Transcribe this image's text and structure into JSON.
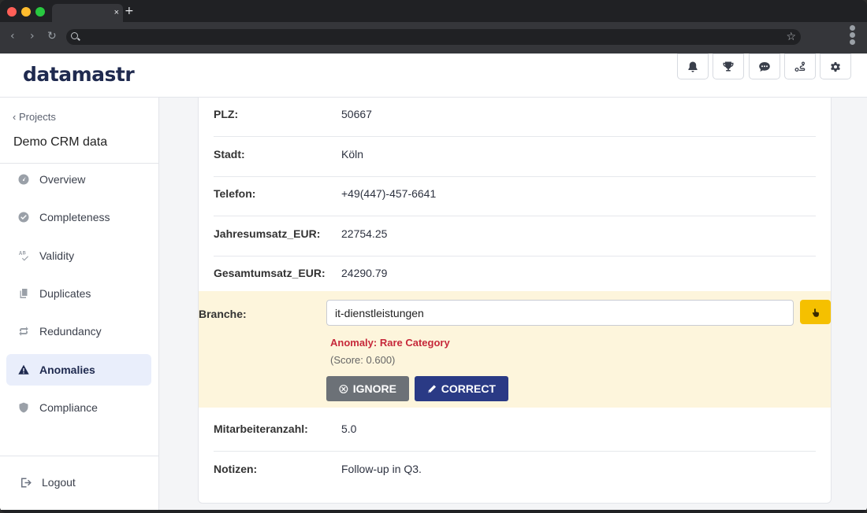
{
  "browser": {
    "tab_title": "",
    "tab_close": "×",
    "new_tab": "+",
    "nav_back": "‹",
    "nav_forward": "›",
    "nav_reload": "↻",
    "address": "",
    "bookmark_star": "☆"
  },
  "app": {
    "logo": "datamastr",
    "header_icons": [
      "bell-icon",
      "trophy-icon",
      "chat-icon",
      "route-icon",
      "gear-icon"
    ]
  },
  "sidebar": {
    "back_label": "‹  Projects",
    "project_name": "Demo CRM data",
    "items": [
      {
        "label": "Overview",
        "icon": "gauge-icon",
        "active": false
      },
      {
        "label": "Completeness",
        "icon": "check-circle-icon",
        "active": false
      },
      {
        "label": "Validity",
        "icon": "spellcheck-icon",
        "active": false
      },
      {
        "label": "Duplicates",
        "icon": "copy-icon",
        "active": false
      },
      {
        "label": "Redundancy",
        "icon": "sync-icon",
        "active": false
      },
      {
        "label": "Anomalies",
        "icon": "warning-icon",
        "active": true
      },
      {
        "label": "Compliance",
        "icon": "shield-icon",
        "active": false
      }
    ],
    "logout": "Logout"
  },
  "record": {
    "fields_top": [
      {
        "label": "PLZ:",
        "value": "50667"
      },
      {
        "label": "Stadt:",
        "value": "Köln"
      },
      {
        "label": "Telefon:",
        "value": "+49(447)-457-6641"
      },
      {
        "label": "Jahresumsatz_EUR:",
        "value": "22754.25"
      },
      {
        "label": "Gesamtumsatz_EUR:",
        "value": "24290.79"
      }
    ],
    "anomaly": {
      "label": "Branche:",
      "value": "it-dienstleistungen",
      "title": "Anomaly: Rare Category",
      "score": "(Score: 0.600)",
      "ignore_label": "IGNORE",
      "correct_label": "CORRECT"
    },
    "fields_bottom": [
      {
        "label": "Mitarbeiteranzahl:",
        "value": "5.0"
      },
      {
        "label": "Notizen:",
        "value": "Follow-up in Q3."
      }
    ]
  },
  "colors": {
    "brand": "#1f2a4f",
    "accent": "#2a3a85",
    "warning_bg": "#fdf5dc",
    "warning_button": "#f5c000",
    "danger": "#c6283a"
  }
}
